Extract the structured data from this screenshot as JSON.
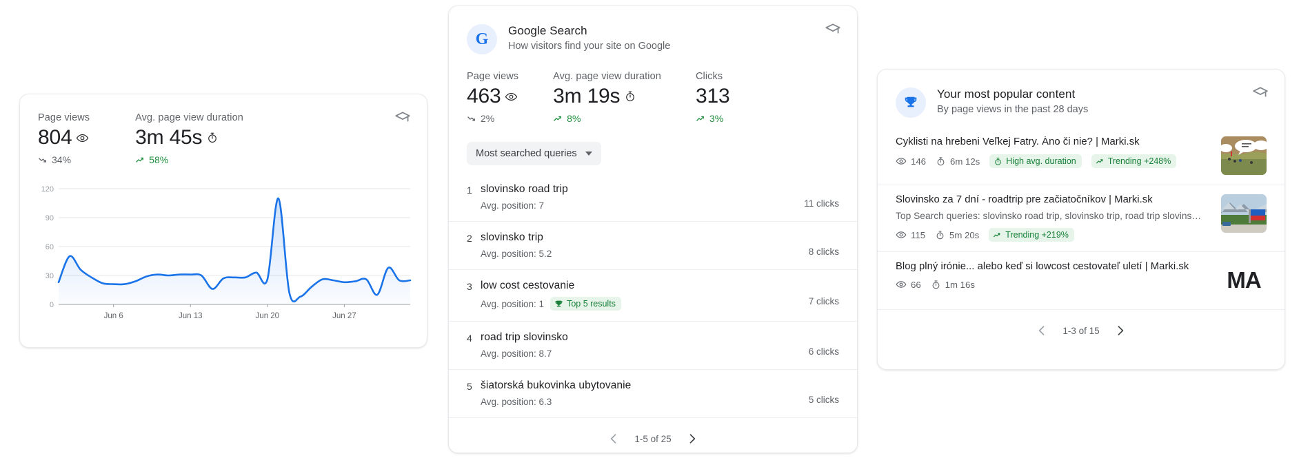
{
  "colors": {
    "accent_blue": "#1a73e8",
    "line_blue": "#1a73e8",
    "green": "#1e8e3e",
    "badge_green_bg": "#e6f4ea",
    "text_primary": "#202124",
    "text_secondary": "#5f6368",
    "card_border": "#e8eaed"
  },
  "pageviews_card": {
    "learn_icon": "graduation-cap-icon",
    "metrics": [
      {
        "label": "Page views",
        "value": "804",
        "icon": "eye-icon",
        "delta": "34%",
        "delta_direction": "down",
        "delta_icon": "trend-down-icon"
      },
      {
        "label": "Avg. page view duration",
        "value": "3m 45s",
        "icon": "stopwatch-icon",
        "delta": "58%",
        "delta_direction": "up",
        "delta_icon": "trend-up-icon"
      }
    ]
  },
  "chart_data": {
    "type": "area",
    "title": "Page views",
    "xlabel": "",
    "ylabel": "",
    "ylim": [
      0,
      120
    ],
    "yticks": [
      0,
      30,
      60,
      90,
      120
    ],
    "ytick_labels": [
      "0",
      "30",
      "60",
      "90",
      "120"
    ],
    "grid": true,
    "legend": "none",
    "x": [
      "Jun 1",
      "Jun 2",
      "Jun 3",
      "Jun 4",
      "Jun 5",
      "Jun 6",
      "Jun 7",
      "Jun 8",
      "Jun 9",
      "Jun 10",
      "Jun 11",
      "Jun 12",
      "Jun 13",
      "Jun 14",
      "Jun 15",
      "Jun 16",
      "Jun 17",
      "Jun 18",
      "Jun 19",
      "Jun 20",
      "Jun 21",
      "Jun 22",
      "Jun 23",
      "Jun 24",
      "Jun 25",
      "Jun 26",
      "Jun 27",
      "Jun 28",
      "Jun 29",
      "Jun 30"
    ],
    "xtick_labels": [
      "Jun 6",
      "Jun 13",
      "Jun 20",
      "Jun 27"
    ],
    "xtick_indices": [
      5,
      12,
      19,
      26
    ],
    "values": [
      23,
      50,
      36,
      28,
      22,
      21,
      21,
      24,
      29,
      31,
      30,
      31,
      31,
      30,
      16,
      27,
      28,
      28,
      33,
      26,
      110,
      12,
      8,
      18,
      26,
      25,
      23,
      24,
      26,
      10
    ],
    "tail_values": [
      38,
      25,
      25
    ]
  },
  "search_card": {
    "avatar_icon": "google-g-icon",
    "avatar_letter": "G",
    "title": "Google Search",
    "subtitle": "How visitors find your site on Google",
    "learn_icon": "graduation-cap-icon",
    "metrics": [
      {
        "label": "Page views",
        "value": "463",
        "icon": "eye-icon",
        "delta": "2%",
        "delta_direction": "down",
        "delta_icon": "trend-down-icon"
      },
      {
        "label": "Avg. page view duration",
        "value": "3m 19s",
        "icon": "stopwatch-icon",
        "delta": "8%",
        "delta_direction": "up",
        "delta_icon": "trend-up-icon"
      },
      {
        "label": "Clicks",
        "value": "313",
        "icon": "none",
        "delta": "3%",
        "delta_direction": "up",
        "delta_icon": "trend-up-icon"
      }
    ],
    "filter_select": {
      "selected": "Most searched queries",
      "caret_icon": "chevron-down-icon"
    },
    "queries": [
      {
        "rank": "1",
        "query": "slovinsko road trip",
        "position": "Avg. position: 7",
        "badge": null,
        "clicks": "11 clicks"
      },
      {
        "rank": "2",
        "query": "slovinsko trip",
        "position": "Avg. position: 5.2",
        "badge": null,
        "clicks": "8 clicks"
      },
      {
        "rank": "3",
        "query": "low cost cestovanie",
        "position": "Avg. position: 1",
        "badge": {
          "label": "Top 5 results",
          "icon": "trophy-icon"
        },
        "clicks": "7 clicks"
      },
      {
        "rank": "4",
        "query": "road trip slovinsko",
        "position": "Avg. position: 8.7",
        "badge": null,
        "clicks": "6 clicks"
      },
      {
        "rank": "5",
        "query": "šiatorská bukovinka ubytovanie",
        "position": "Avg. position: 6.3",
        "badge": null,
        "clicks": "5 clicks"
      }
    ],
    "pagination": {
      "prev_icon": "chevron-left-icon",
      "range": "1-5 of 25",
      "next_icon": "chevron-right-icon"
    }
  },
  "popular_card": {
    "avatar_icon": "trophy-icon",
    "title": "Your most popular content",
    "subtitle": "By page views in the past 28 days",
    "learn_icon": "graduation-cap-icon",
    "items": [
      {
        "title": "Cyklisti na hrebeni Veľkej Fatry. Áno či nie? | Marki.sk",
        "queries": null,
        "views": "146",
        "views_icon": "eye-icon",
        "duration": "6m 12s",
        "duration_icon": "stopwatch-icon",
        "badges": [
          {
            "label": "High avg. duration",
            "icon": "stopwatch-icon"
          },
          {
            "label": "Trending +248%",
            "icon": "trend-up-icon"
          }
        ],
        "thumbnail": "hikers-on-mountain-ridge-photo"
      },
      {
        "title": "Slovinsko za 7 dní - roadtrip pre začiatočníkov | Marki.sk",
        "queries": "Top Search queries: slovinsko road trip, slovinsko trip, road trip slovins…",
        "views": "115",
        "views_icon": "eye-icon",
        "duration": "5m 20s",
        "duration_icon": "stopwatch-icon",
        "badges": [
          {
            "label": "Trending +219%",
            "icon": "trend-up-icon"
          }
        ],
        "thumbnail": "mountains-with-red-sign-photo"
      },
      {
        "title": "Blog plný irónie... alebo keď si lowcost cestovateľ uletí | Marki.sk",
        "queries": null,
        "views": "66",
        "views_icon": "eye-icon",
        "duration": "1m 16s",
        "duration_icon": "stopwatch-icon",
        "badges": [],
        "thumbnail": "MA-logo-wordmark",
        "thumbnail_text": "MA"
      }
    ],
    "pagination": {
      "prev_icon": "chevron-left-icon",
      "range": "1-3 of 15",
      "next_icon": "chevron-right-icon"
    }
  }
}
